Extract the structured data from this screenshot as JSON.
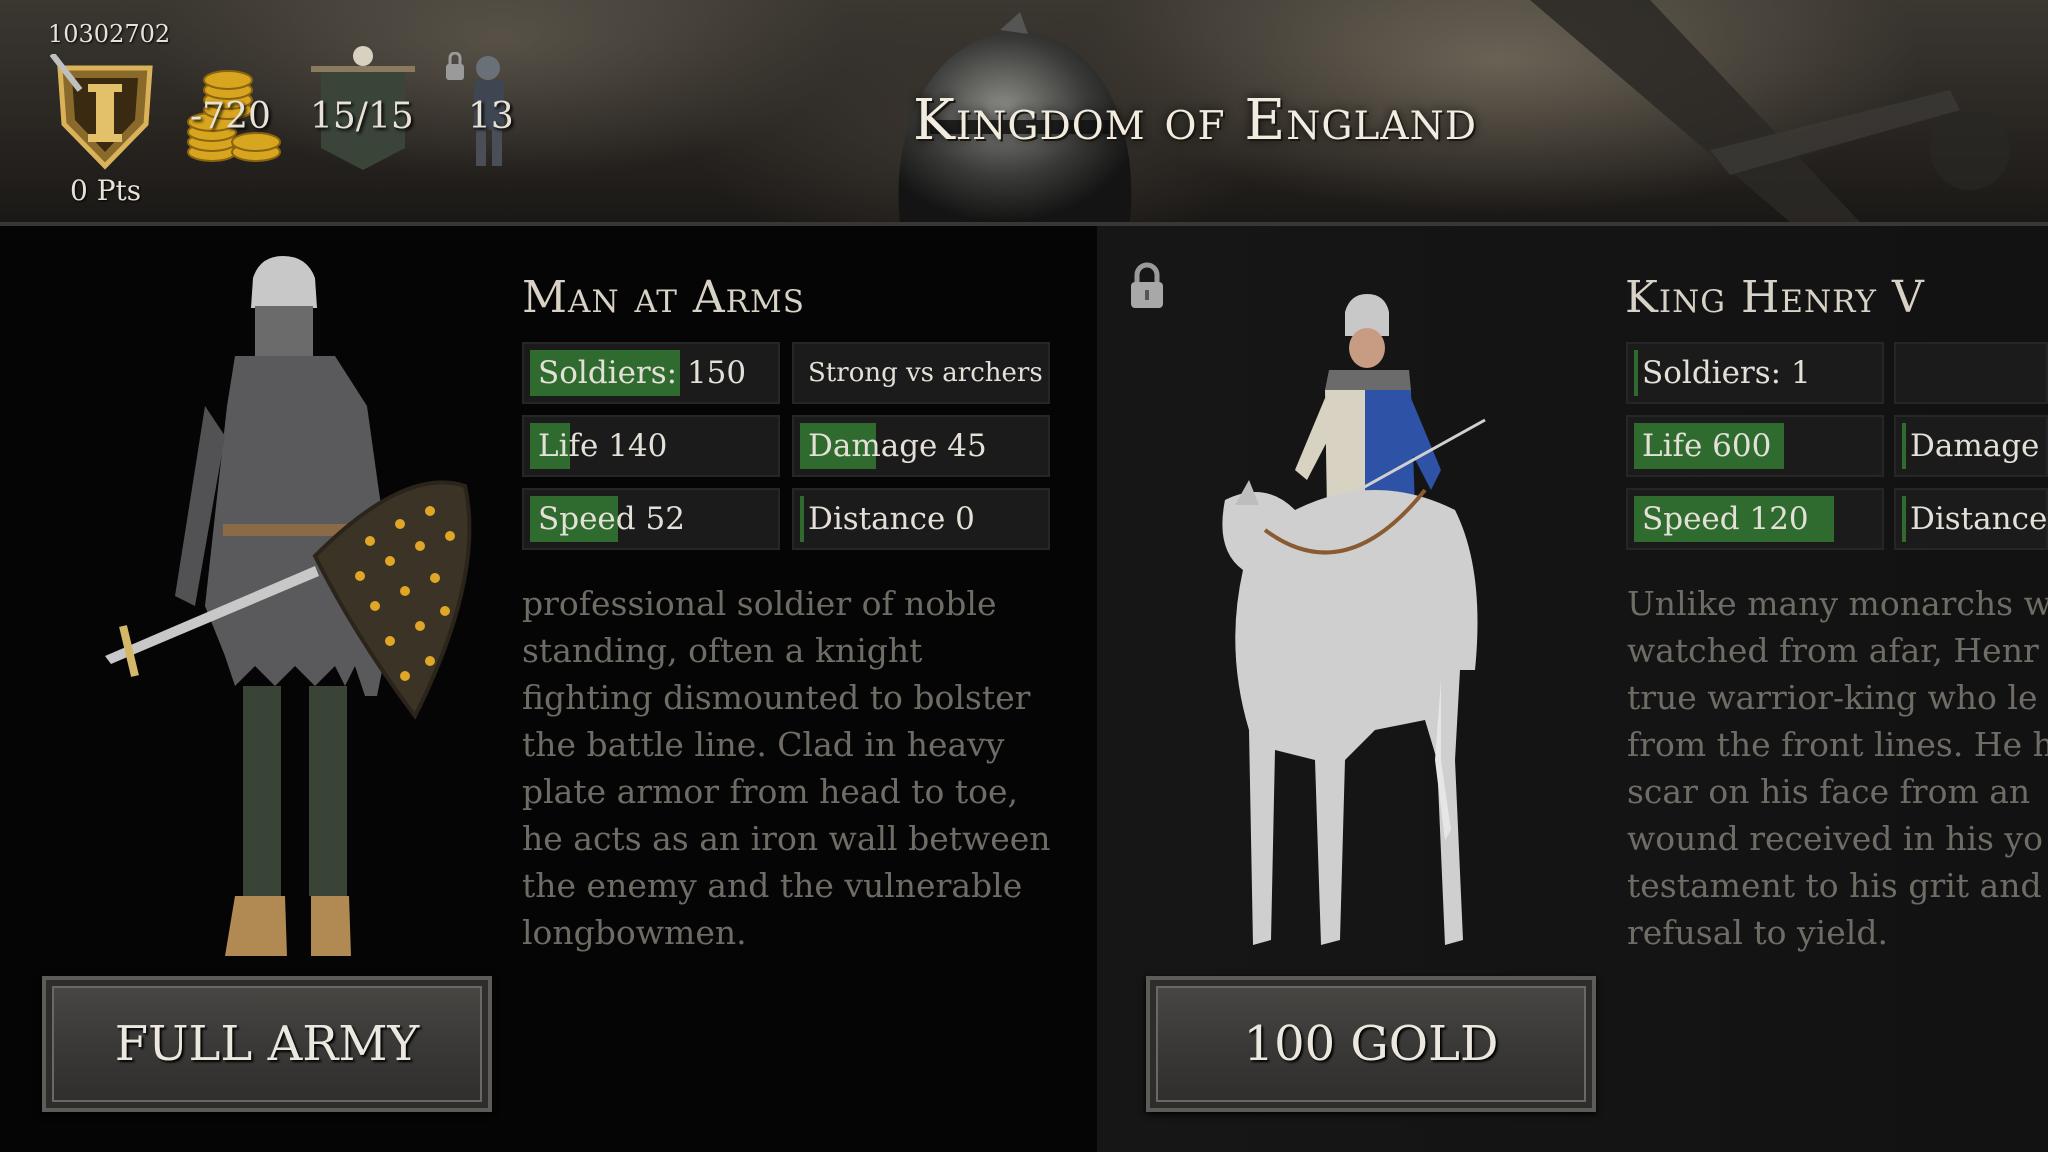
{
  "header": {
    "player_id": "10302702",
    "points": "0 Pts",
    "gold": "-720",
    "banners": "15/15",
    "units": "13",
    "title": "Kingdom of England"
  },
  "icons": {
    "rank": "rank-shield-icon",
    "gold": "gold-coins-icon",
    "banner": "banner-icon",
    "units": "locked-knight-icon",
    "lock": "padlock-icon"
  },
  "units": [
    {
      "name": "Man at Arms",
      "stats": [
        {
          "label": "Soldiers: 150",
          "fill": 0.45
        },
        {
          "label": "Strong vs archers",
          "fill": 0
        },
        {
          "label": "Life 140",
          "fill": 0.1
        },
        {
          "label": "Damage 45",
          "fill": 0.02
        },
        {
          "label": "Speed 52",
          "fill": 0.25
        },
        {
          "label": "Distance 0",
          "fill": 0.01
        }
      ],
      "description": "professional soldier of noble\nstanding, often a knight\nfighting dismounted to bolster\nthe battle line. Clad in heavy\nplate armor from head to toe,\nhe acts as an iron wall between\nthe enemy and the vulnerable\nlongbowmen.",
      "button": "FULL ARMY",
      "locked": false
    },
    {
      "name": "King Henry V",
      "stats": [
        {
          "label": "Soldiers: 1",
          "fill": 0.01
        },
        {
          "label": "",
          "fill": 0
        },
        {
          "label": "Life 600",
          "fill": 0.45
        },
        {
          "label": "Damage",
          "fill": 0.02
        },
        {
          "label": "Speed 120",
          "fill": 0.6
        },
        {
          "label": "Distance",
          "fill": 0.01
        }
      ],
      "description": "Unlike many monarchs w\nwatched from afar, Henr\ntrue warrior-king who le\nfrom the front lines. He h\nscar on his face from an\nwound received in his yo\ntestament to his grit and\nrefusal to yield.",
      "button": "100 GOLD",
      "locked": true
    }
  ],
  "colors": {
    "stat_fill": "#2f6b2e",
    "panel_left": "#050505",
    "panel_right": "#141414",
    "title_text": "#f2ece0"
  }
}
